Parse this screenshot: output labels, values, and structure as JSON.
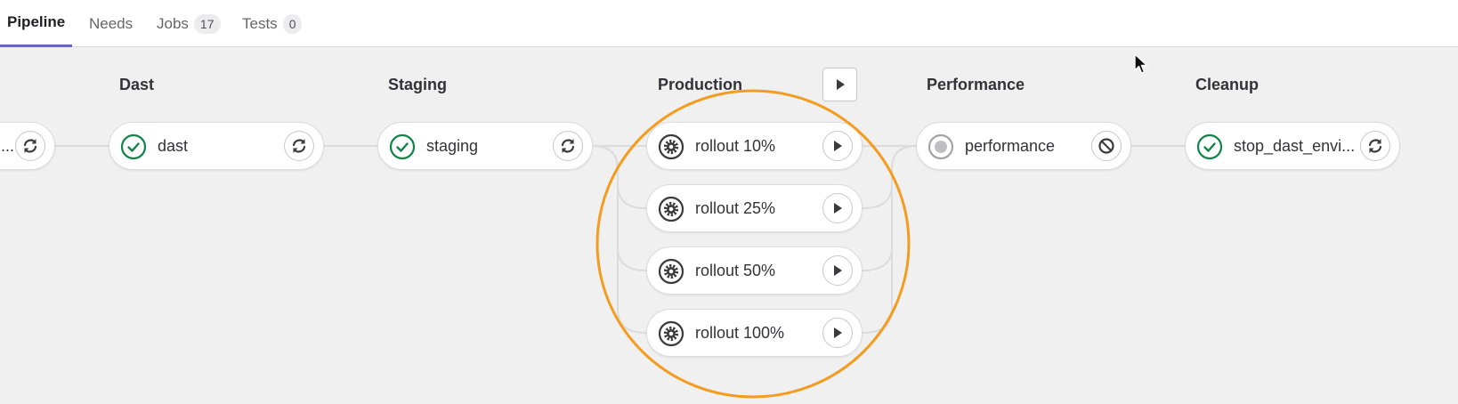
{
  "tabs": [
    {
      "label": "Pipeline",
      "active": true
    },
    {
      "label": "Needs"
    },
    {
      "label": "Jobs",
      "count": "17"
    },
    {
      "label": "Tests",
      "count": "0"
    }
  ],
  "stages": [
    {
      "title": "Dast"
    },
    {
      "title": "Staging"
    },
    {
      "title": "Production"
    },
    {
      "title": "Performance"
    },
    {
      "title": "Cleanup"
    }
  ],
  "jobs": {
    "prev": {
      "name": "...",
      "status_icon": "success-icon",
      "action_icon": "retry-icon"
    },
    "dast": {
      "name": "dast",
      "status_icon": "success-icon",
      "action_icon": "retry-icon"
    },
    "staging": {
      "name": "staging",
      "status_icon": "success-icon",
      "action_icon": "retry-icon"
    },
    "rollout10": {
      "name": "rollout 10%",
      "status_icon": "manual-gear-icon",
      "action_icon": "play-icon"
    },
    "rollout25": {
      "name": "rollout 25%",
      "status_icon": "manual-gear-icon",
      "action_icon": "play-icon"
    },
    "rollout50": {
      "name": "rollout 50%",
      "status_icon": "manual-gear-icon",
      "action_icon": "play-icon"
    },
    "rollout100": {
      "name": "rollout 100%",
      "status_icon": "manual-gear-icon",
      "action_icon": "play-icon"
    },
    "performance": {
      "name": "performance",
      "status_icon": "created-icon",
      "action_icon": "cancel-icon"
    },
    "cleanup": {
      "name": "stop_dast_envi...",
      "status_icon": "success-icon",
      "action_icon": "retry-icon"
    }
  },
  "colors": {
    "success": "#108548",
    "highlight": "#f39c1f",
    "tab_active_underline": "#6666c4",
    "background": "#f0f0f0"
  }
}
